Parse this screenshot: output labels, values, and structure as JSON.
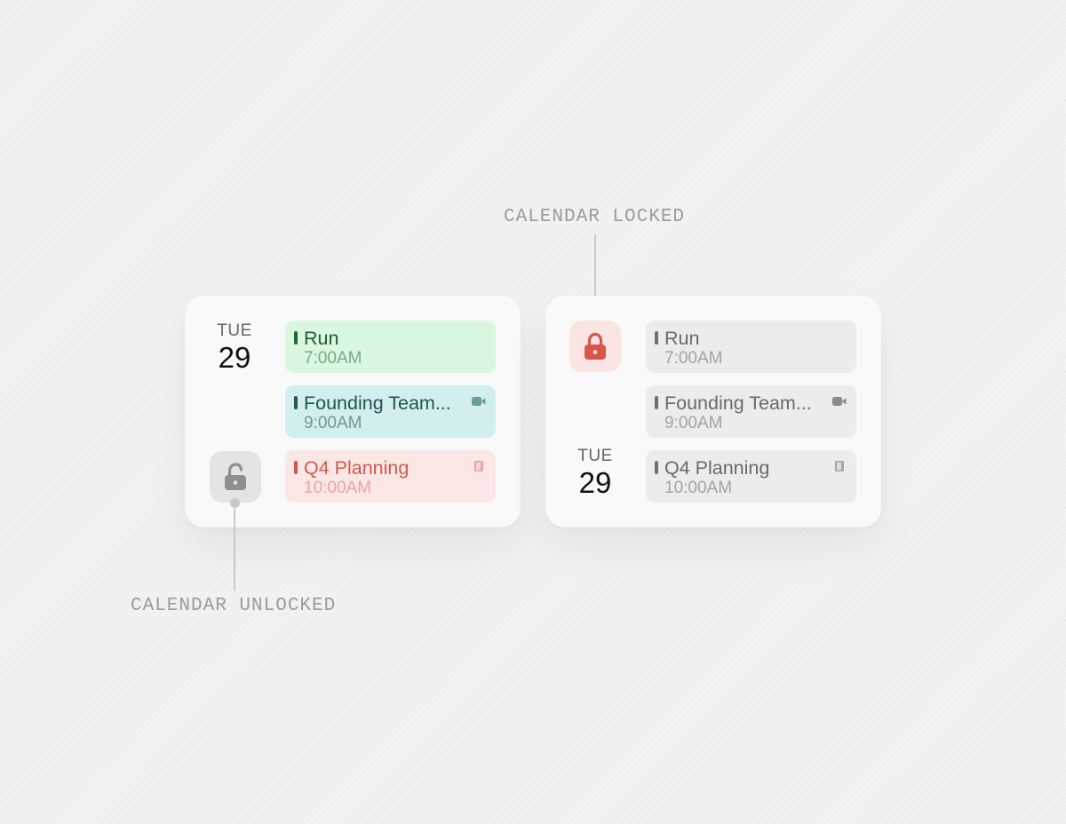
{
  "callouts": {
    "locked": "CALENDAR LOCKED",
    "unlocked": "CALENDAR UNLOCKED"
  },
  "cards": {
    "unlocked": {
      "date": {
        "dow": "TUE",
        "day": "29"
      },
      "lock_icon": "lock-open-icon",
      "events": [
        {
          "title": "Run",
          "time": "7:00AM",
          "icon": null
        },
        {
          "title": "Founding Team...",
          "time": "9:00AM",
          "icon": "video-icon"
        },
        {
          "title": "Q4 Planning",
          "time": "10:00AM",
          "icon": "door-icon"
        }
      ]
    },
    "locked": {
      "date": {
        "dow": "TUE",
        "day": "29"
      },
      "lock_icon": "lock-closed-icon",
      "events": [
        {
          "title": "Run",
          "time": "7:00AM",
          "icon": null
        },
        {
          "title": "Founding Team...",
          "time": "9:00AM",
          "icon": "video-icon"
        },
        {
          "title": "Q4 Planning",
          "time": "10:00AM",
          "icon": "door-icon"
        }
      ]
    }
  },
  "colors": {
    "run_green": "#d9f8df",
    "founding_teal": "#d2eeee",
    "planning_red": "#fbe8e6",
    "lock_red": "#d8564c",
    "locked_gray": "#ececec"
  }
}
